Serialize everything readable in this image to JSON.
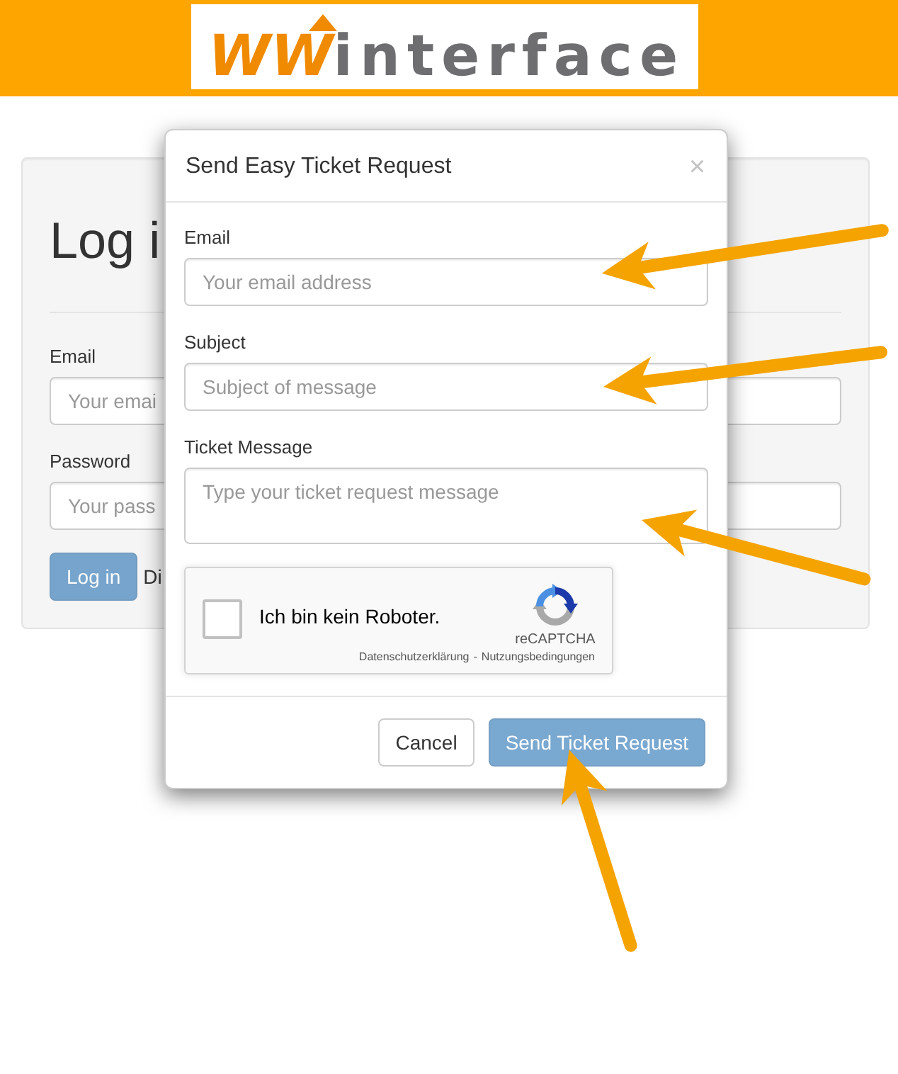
{
  "header": {
    "logo": {
      "accent": "WW",
      "name": "interface"
    }
  },
  "login": {
    "heading": "Log i",
    "fields": [
      {
        "label": "Email",
        "placeholder": "Your emai"
      },
      {
        "label": "Password",
        "placeholder": "Your pass"
      }
    ],
    "button": {
      "label": "Log in",
      "disabled": true
    },
    "trailing_text": "Di"
  },
  "modal": {
    "title": "Send Easy Ticket Request",
    "close": "×",
    "fields": [
      {
        "kind": "input",
        "label": "Email",
        "placeholder": "Your email address",
        "callout": true
      },
      {
        "kind": "input",
        "label": "Subject",
        "placeholder": "Subject of message",
        "callout": true
      },
      {
        "kind": "textarea",
        "label": "Ticket Message",
        "placeholder": "Type your ticket request message",
        "callout": true
      }
    ],
    "captcha": {
      "checked": false,
      "label": "Ich bin kein Roboter.",
      "brand": "reCAPTCHA",
      "links": [
        "Datenschutzerklärung",
        "Nutzungsbedingungen"
      ],
      "separator": "-"
    },
    "buttons": [
      {
        "kind": "default",
        "label": "Cancel",
        "disabled": false,
        "callout": false
      },
      {
        "kind": "primary",
        "label": "Send Ticket Request",
        "disabled": true,
        "callout": true
      }
    ]
  }
}
